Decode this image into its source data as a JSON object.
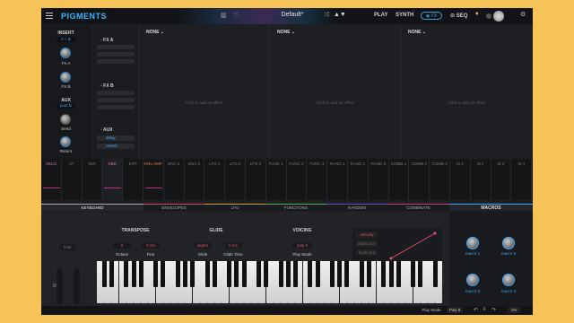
{
  "app": {
    "title": "PIGMENTS",
    "preset": "Default*"
  },
  "header": {
    "tabs": [
      "PLAY",
      "SYNTH",
      "FX",
      "SEQ"
    ]
  },
  "left": {
    "insert": "INSERT",
    "routing": "A + B",
    "fxa": "FX A",
    "fxb": "FX B",
    "aux": "AUX",
    "aux_src": "post fx",
    "send": "Send",
    "return": "Return"
  },
  "fx_slots": [
    {
      "name": "FX A"
    },
    {
      "name": "FX B"
    },
    {
      "name": "AUX",
      "items": [
        "delay",
        "reverb"
      ]
    }
  ],
  "fx_panels": [
    {
      "name": "NONE",
      "hint": "Click to add an effect"
    },
    {
      "name": "NONE",
      "hint": "Click to add an effect"
    },
    {
      "name": "NONE",
      "hint": "Click to add an effect"
    }
  ],
  "mods": [
    "VELO",
    "AT",
    "MW",
    "KBD",
    "EXP",
    "ENV AMP",
    "ENV 2",
    "ENV 3",
    "LFO 1",
    "LFO 2",
    "LFO 3",
    "FUNC 1",
    "FUNC 2",
    "FUNC 3",
    "RAND 1",
    "RAND 2",
    "RAND 3",
    "COMB 1",
    "COMB 2",
    "COMB 3",
    "M 1",
    "M 2",
    "M 3",
    "M 4"
  ],
  "categories": [
    "KEYBOARD",
    "ENVELOPES",
    "LFO",
    "FUNCTIONS",
    "RANDOM",
    "COMBINATE"
  ],
  "bottom": {
    "hold": "hold",
    "transpose": "TRANSPOSE",
    "oct_val": "0",
    "fine_val": "0 cts",
    "octave": "Octave",
    "fine": "Fine",
    "glide": "GLIDE",
    "glide_mode": "legato",
    "glide_time_val": "0 ms",
    "glide_lbl": "Glide",
    "glide_time": "Glide Time",
    "voicing": "VOICING",
    "play_mode_val": "poly 8",
    "play_mode": "Play Mode",
    "vel_opts": [
      "velocity",
      "aftertouch",
      "keyboard"
    ]
  },
  "macros": {
    "title": "MACROS",
    "names": [
      "macro 1",
      "macro 2",
      "macro 3",
      "macro 4"
    ]
  },
  "status": {
    "play_mode": "Play Mode",
    "poly": "Poly 8",
    "zoom": "1%"
  },
  "colors": {
    "accent": "#38b8ff",
    "env": "#e0506a",
    "keyboard_tab": "#1d1e21",
    "macros_line": "#3aa8ff"
  }
}
